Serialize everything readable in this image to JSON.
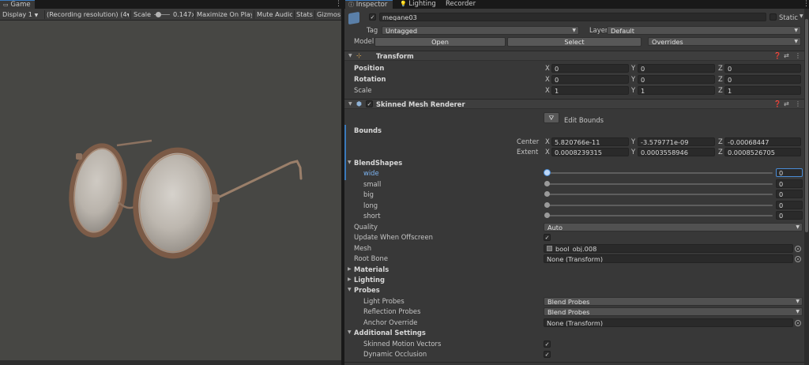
{
  "game": {
    "tab_label": "Game",
    "display": "Display 1",
    "resolution": "(Recording resolution) (4",
    "scale_label": "Scale",
    "scale_value": "0.147x",
    "maximize": "Maximize On Play",
    "mute": "Mute Audio",
    "stats": "Stats",
    "gizmos": "Gizmos"
  },
  "tabs": {
    "inspector": "Inspector",
    "lighting": "Lighting",
    "recorder": "Recorder"
  },
  "object": {
    "name": "megane03",
    "static_label": "Static",
    "tag_label": "Tag",
    "tag_value": "Untagged",
    "layer_label": "Layer",
    "layer_value": "Default",
    "model_label": "Model",
    "open": "Open",
    "select": "Select",
    "overrides": "Overrides"
  },
  "transform": {
    "title": "Transform",
    "position": {
      "label": "Position",
      "x": "0",
      "y": "0",
      "z": "0"
    },
    "rotation": {
      "label": "Rotation",
      "x": "0",
      "y": "0",
      "z": "0"
    },
    "scale": {
      "label": "Scale",
      "x": "1",
      "y": "1",
      "z": "1"
    }
  },
  "axes": {
    "x": "X",
    "y": "Y",
    "z": "Z"
  },
  "renderer": {
    "title": "Skinned Mesh Renderer",
    "edit_bounds": "Edit Bounds",
    "bounds_label": "Bounds",
    "center_label": "Center",
    "center": {
      "x": "5.820766e-11",
      "y": "-3.579771e-09",
      "z": "-0.00068447"
    },
    "extent_label": "Extent",
    "extent": {
      "x": "0.0008239315",
      "y": "0.0003558946",
      "z": "0.0008526705"
    },
    "blendshapes_label": "BlendShapes",
    "blendshapes": [
      {
        "name": "wide",
        "value": "0"
      },
      {
        "name": "small",
        "value": "0"
      },
      {
        "name": "big",
        "value": "0"
      },
      {
        "name": "long",
        "value": "0"
      },
      {
        "name": "short",
        "value": "0"
      }
    ],
    "quality_label": "Quality",
    "quality_value": "Auto",
    "update_offscreen_label": "Update When Offscreen",
    "mesh_label": "Mesh",
    "mesh_value": "bool_obj.008",
    "root_bone_label": "Root Bone",
    "root_bone_value": "None (Transform)",
    "materials_label": "Materials",
    "lighting_label": "Lighting",
    "probes_label": "Probes",
    "light_probes_label": "Light Probes",
    "light_probes_value": "Blend Probes",
    "reflection_probes_label": "Reflection Probes",
    "reflection_probes_value": "Blend Probes",
    "anchor_override_label": "Anchor Override",
    "anchor_override_value": "None (Transform)",
    "additional_label": "Additional Settings",
    "motion_vectors_label": "Skinned Motion Vectors",
    "dynamic_occlusion_label": "Dynamic Occlusion"
  },
  "colors": {
    "accent": "#3a79bb",
    "panel": "#383838",
    "viewport": "#474744"
  }
}
